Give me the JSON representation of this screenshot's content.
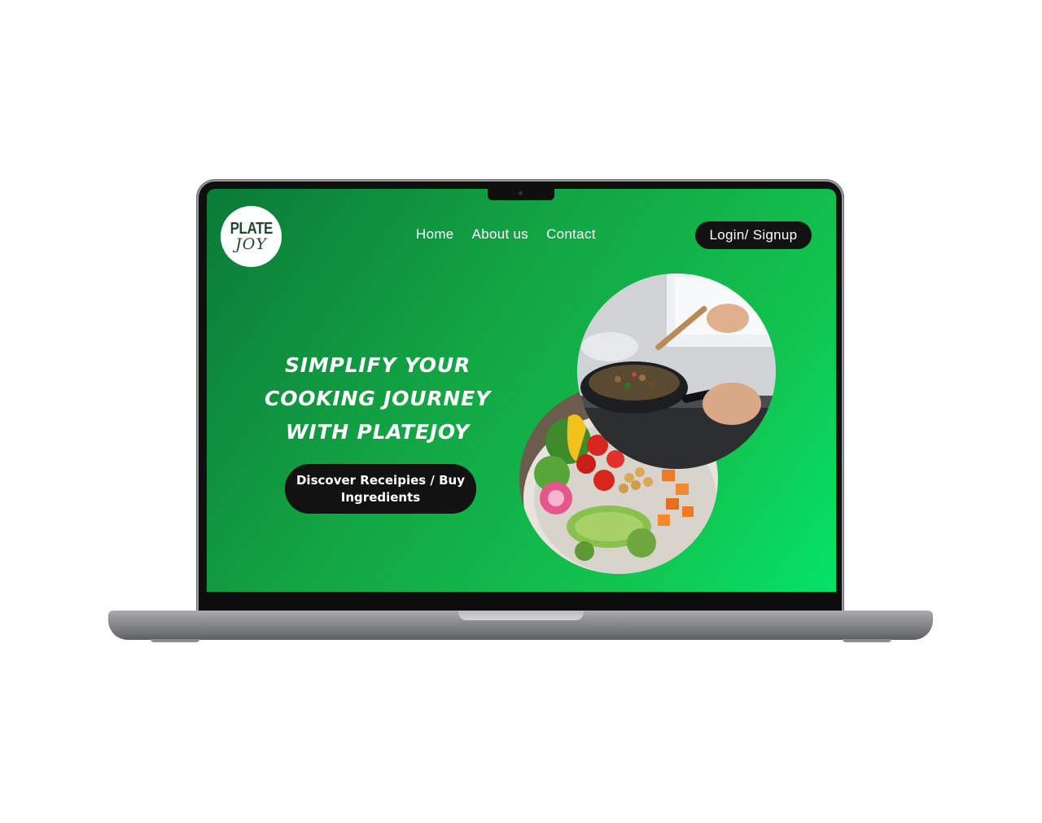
{
  "site": {
    "logo": {
      "line1": "PLATE",
      "line2": "JOY"
    },
    "nav": [
      {
        "label": "Home"
      },
      {
        "label": "About us"
      },
      {
        "label": "Contact"
      }
    ],
    "login_label": "Login/ Signup",
    "hero": {
      "headline": [
        "SIMPLIFY YOUR",
        "COOKING JOURNEY",
        "WITH PLATEJOY"
      ],
      "cta_label": "Discover Receipies / Buy Ingredients"
    }
  },
  "colors": {
    "gradient_start": "#0a7a38",
    "gradient_end": "#04e36a",
    "button_bg": "#121212",
    "logo_text": "#1f4a2c"
  }
}
